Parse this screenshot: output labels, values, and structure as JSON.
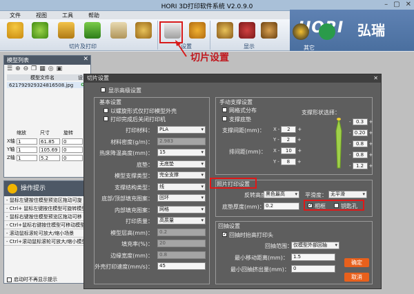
{
  "app": {
    "title": "HORI 3D打印软件系统 V2.0.9.0",
    "menus": [
      "文件",
      "视图",
      "工具",
      "帮助"
    ],
    "logo_text": "HORI",
    "logo_cn": "弘瑞"
  },
  "ribbon": {
    "groups": [
      "切片及打印",
      "设置",
      "显示",
      "其它"
    ]
  },
  "annotation": "切片设置",
  "model_panel": {
    "title": "模型列表",
    "col_file": "模型文件名",
    "col_state": "设",
    "file": "621792929324816508.jpg",
    "headers": [
      "缩放",
      "尺寸",
      "旋转"
    ],
    "rows": [
      {
        "axis": "X轴",
        "scale": "1",
        "size": "61.85",
        "rot": "0"
      },
      {
        "axis": "Y轴",
        "scale": "1",
        "size": "105.69",
        "rot": "0"
      },
      {
        "axis": "Z轴",
        "scale": "1",
        "size": "5.2",
        "rot": "0"
      }
    ]
  },
  "tips": {
    "title": "操作提示",
    "lines": [
      "- 鼠标左键按住模型预览区拖动可旋",
      "- Ctrl+ 鼠标左键按住模型可旋转模型",
      "- 鼠标右键按住模型预览区拖动可移",
      "- Ctrl+鼠标右键按住模型可移动模型",
      "- 滚动鼠标滚轮可放大/缩小场景",
      "- Ctrl+滚动鼠标滚轮可放大/缩小模型"
    ],
    "startup": "启动时不再显示提示"
  },
  "dialog": {
    "title": "切片设置",
    "advanced": "显示高级设置",
    "basic": {
      "title": "基本设置",
      "opt1": "以螺旋形式仅打印模型外壳",
      "opt2": "打印完成后关闭打印机",
      "fields": [
        {
          "label": "打印材料：",
          "value": "PLA",
          "type": "select"
        },
        {
          "label": "材料密度(g/m)：",
          "value": "2.983",
          "type": "dis"
        },
        {
          "label": "热床降温高度(mm)：",
          "value": "15",
          "type": "select"
        },
        {
          "label": "底垫：",
          "value": "无底垫",
          "type": "select"
        },
        {
          "label": "模型支撑类型：",
          "value": "完全支撑",
          "type": "select"
        },
        {
          "label": "支撑结构类型：",
          "value": "线",
          "type": "select"
        },
        {
          "label": "底部/顶部填充图案：",
          "value": "回环",
          "type": "select"
        },
        {
          "label": "内部填充图案：",
          "value": "网格",
          "type": "select"
        },
        {
          "label": "打印质量：",
          "value": "高质量",
          "type": "select"
        },
        {
          "label": "模型层高(mm)：",
          "value": "0.2",
          "type": "dis"
        },
        {
          "label": "填充率(%)：",
          "value": "20",
          "type": "dis"
        },
        {
          "label": "边缘宽度(mm)：",
          "value": "0.8",
          "type": "dis"
        },
        {
          "label": "外壳打印速度(mm/s)：",
          "value": "45",
          "type": "inp"
        }
      ]
    },
    "manual": {
      "title": "手动支撑设置",
      "grid": "网格式分布",
      "bottom": "支撑底垫",
      "shape": "支撑形状选择：",
      "spacing": "支撑间距(mm)：",
      "row_spacing": "排间距(mm)：",
      "x": "X",
      "y": "Y",
      "sp_x": "2",
      "sp_y": "2",
      "row_x": "10",
      "row_y": "8",
      "right": [
        "0.3",
        "0.20",
        "0.8",
        "0.8",
        "1.2"
      ]
    },
    "photo": {
      "title": "照片打印设置",
      "reverse": "反转高度：",
      "reverse_val": "黑色最高",
      "smooth": "平滑度：",
      "smooth_val": "无平滑",
      "thickness": "底垫厚度(mm)：",
      "thickness_val": "0.2",
      "frame": "相框",
      "keyhole": "钥匙孔"
    },
    "retract": {
      "title": "回抽设置",
      "opt": "回抽时抬高打印头",
      "range": "回抽范围：",
      "range_val": "仅模型外部回抽",
      "min_move": "最小移动距离(mm)：",
      "min_move_val": "1.5",
      "min_extrude": "最小回抽挤出量(mm)：",
      "min_extrude_val": "0"
    },
    "ok": "确定",
    "cancel": "取消"
  }
}
